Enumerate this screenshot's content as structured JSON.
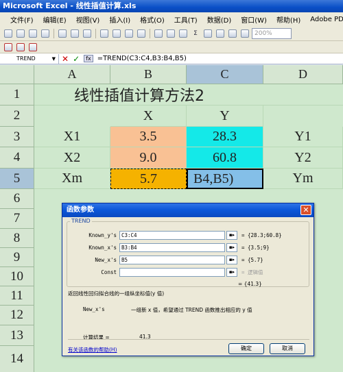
{
  "window_title": "Microsoft Excel - 线性插值计算.xls",
  "menu": [
    "文件(F)",
    "编辑(E)",
    "视图(V)",
    "插入(I)",
    "格式(O)",
    "工具(T)",
    "数据(D)",
    "窗口(W)",
    "帮助(H)",
    "Adobe PDF(B)"
  ],
  "zoom": "200%",
  "formula_bar": {
    "name_box": "TREND",
    "formula": "=TREND(C3:C4,B3:B4,B5)"
  },
  "columns": [
    "A",
    "B",
    "C",
    "D"
  ],
  "rows": [
    "1",
    "2",
    "3",
    "4",
    "5",
    "6",
    "7",
    "8",
    "9",
    "10",
    "11",
    "12",
    "13",
    "14"
  ],
  "cells": {
    "title": "线性插值计算方法2",
    "b2": "X",
    "c2": "Y",
    "a3": "X1",
    "b3": "3.5",
    "c3": "28.3",
    "d3": "Y1",
    "a4": "X2",
    "b4": "9.0",
    "c4": "60.8",
    "d4": "Y2",
    "a5": "Xm",
    "b5": "5.7",
    "c5": "B4,B5)",
    "d5": "Ym"
  },
  "colors": {
    "orange": "#f9c194",
    "cyan": "#14e9e8",
    "gold": "#f5b200",
    "blue_sel": "#84bfe8",
    "sheet_bg": "#cfe8cd"
  },
  "dialog": {
    "title": "函数参数",
    "function_name": "TREND",
    "args": [
      {
        "label": "Known_y's",
        "value": "C3:C4",
        "result": "= {28.3;60.8}"
      },
      {
        "label": "Known_x's",
        "value": "B3:B4",
        "result": "= {3.5;9}"
      },
      {
        "label": "New_x's",
        "value": "B5",
        "result": "= {5.7}"
      },
      {
        "label": "Const",
        "value": "",
        "result": "= 逻辑值"
      }
    ],
    "overall_result": "= {41.3}",
    "description": "返回线性回归拟合线的一组纵坐标值(y 值)",
    "param_name": "New_x's",
    "param_desc": "一组新 x 值，希望通过 TREND 函数推出相应的 y 值",
    "calc_label": "计算结果 =",
    "calc_value": "41.3",
    "help_link": "有关该函数的帮助(H)",
    "ok": "确定",
    "cancel": "取消"
  }
}
